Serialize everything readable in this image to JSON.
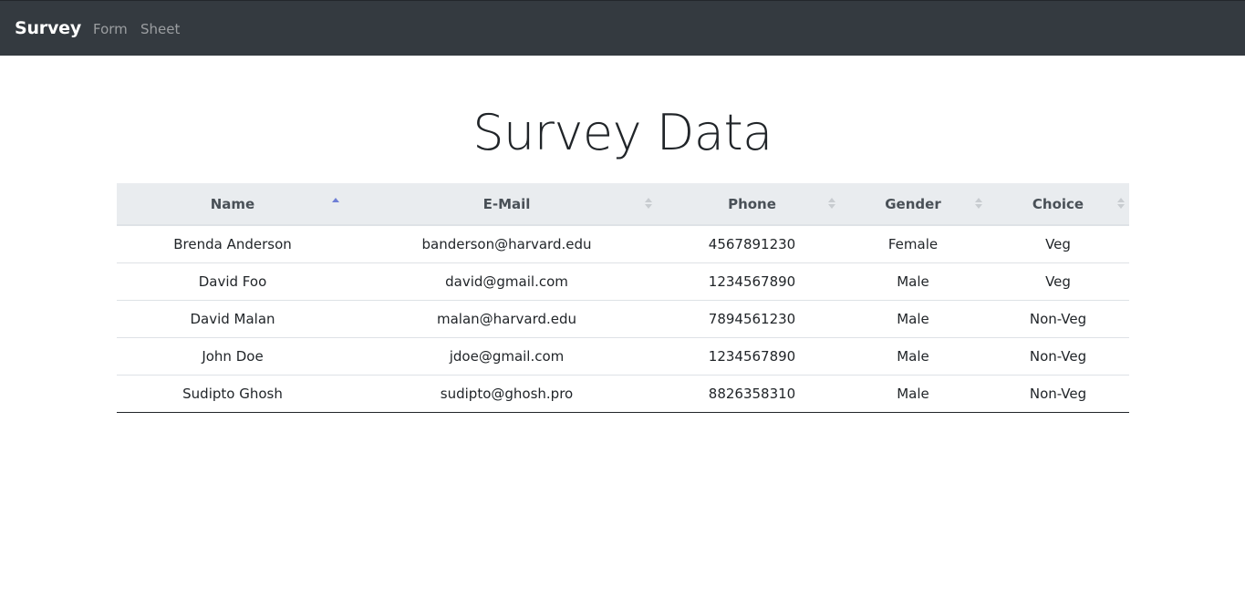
{
  "navbar": {
    "brand": "Survey",
    "links": [
      {
        "label": "Form"
      },
      {
        "label": "Sheet"
      }
    ]
  },
  "page": {
    "title": "Survey Data"
  },
  "table": {
    "columns": [
      {
        "label": "Name",
        "sort": "ascending"
      },
      {
        "label": "E-Mail",
        "sort": "none"
      },
      {
        "label": "Phone",
        "sort": "none"
      },
      {
        "label": "Gender",
        "sort": "none"
      },
      {
        "label": "Choice",
        "sort": "none"
      }
    ],
    "rows": [
      [
        "Brenda Anderson",
        "banderson@harvard.edu",
        "4567891230",
        "Female",
        "Veg"
      ],
      [
        "David Foo",
        "david@gmail.com",
        "1234567890",
        "Male",
        "Veg"
      ],
      [
        "David Malan",
        "malan@harvard.edu",
        "7894561230",
        "Male",
        "Non-Veg"
      ],
      [
        "John Doe",
        "jdoe@gmail.com",
        "1234567890",
        "Male",
        "Non-Veg"
      ],
      [
        "Sudipto Ghosh",
        "sudipto@ghosh.pro",
        "8826358310",
        "Male",
        "Non-Veg"
      ]
    ]
  },
  "colors": {
    "navbar_bg": "#343a40",
    "header_bg": "#e9ecef",
    "sort_active": "#6f7fd6"
  }
}
